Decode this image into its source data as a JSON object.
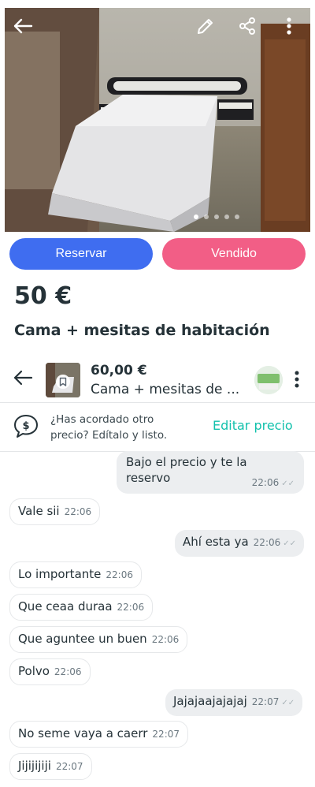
{
  "listing": {
    "photo_count": 5,
    "photo_index": 1,
    "reserve_label": "Reservar",
    "sold_label": "Vendido",
    "price": "50 €",
    "title": "Cama + mesitas de habitación"
  },
  "icons": {
    "back": "arrow-left-icon",
    "edit": "pencil-icon",
    "share": "share-icon",
    "more": "kebab-menu-icon"
  },
  "chat": {
    "price": "60,00 €",
    "item_name": "Cama + mesitas de ...",
    "hint_text": "¿Has acordado otro precio? Edítalo y listo.",
    "hint_action": "Editar precio"
  },
  "messages": [
    {
      "from": "me",
      "text": "Bajo el precio y te la reservo",
      "time": "22:06"
    },
    {
      "from": "other",
      "text": "Vale sii",
      "time": "22:06"
    },
    {
      "from": "me",
      "text": "Ahí esta ya",
      "time": "22:06"
    },
    {
      "from": "other",
      "text": "Lo importante",
      "time": "22:06"
    },
    {
      "from": "other",
      "text": "Que ceaa duraa",
      "time": "22:06"
    },
    {
      "from": "other",
      "text": "Que aguntee un buen",
      "time": "22:06"
    },
    {
      "from": "other",
      "text": "Polvo",
      "time": "22:06"
    },
    {
      "from": "me",
      "text": "Jajajaajajajaj",
      "time": "22:07"
    },
    {
      "from": "other",
      "text": "No seme vaya a caerr",
      "time": "22:07"
    },
    {
      "from": "other",
      "text": "Jijijijiji",
      "time": "22:07"
    }
  ],
  "colors": {
    "reserve": "#3f6df0",
    "sold": "#f25e86",
    "accent": "#13c1ac"
  }
}
